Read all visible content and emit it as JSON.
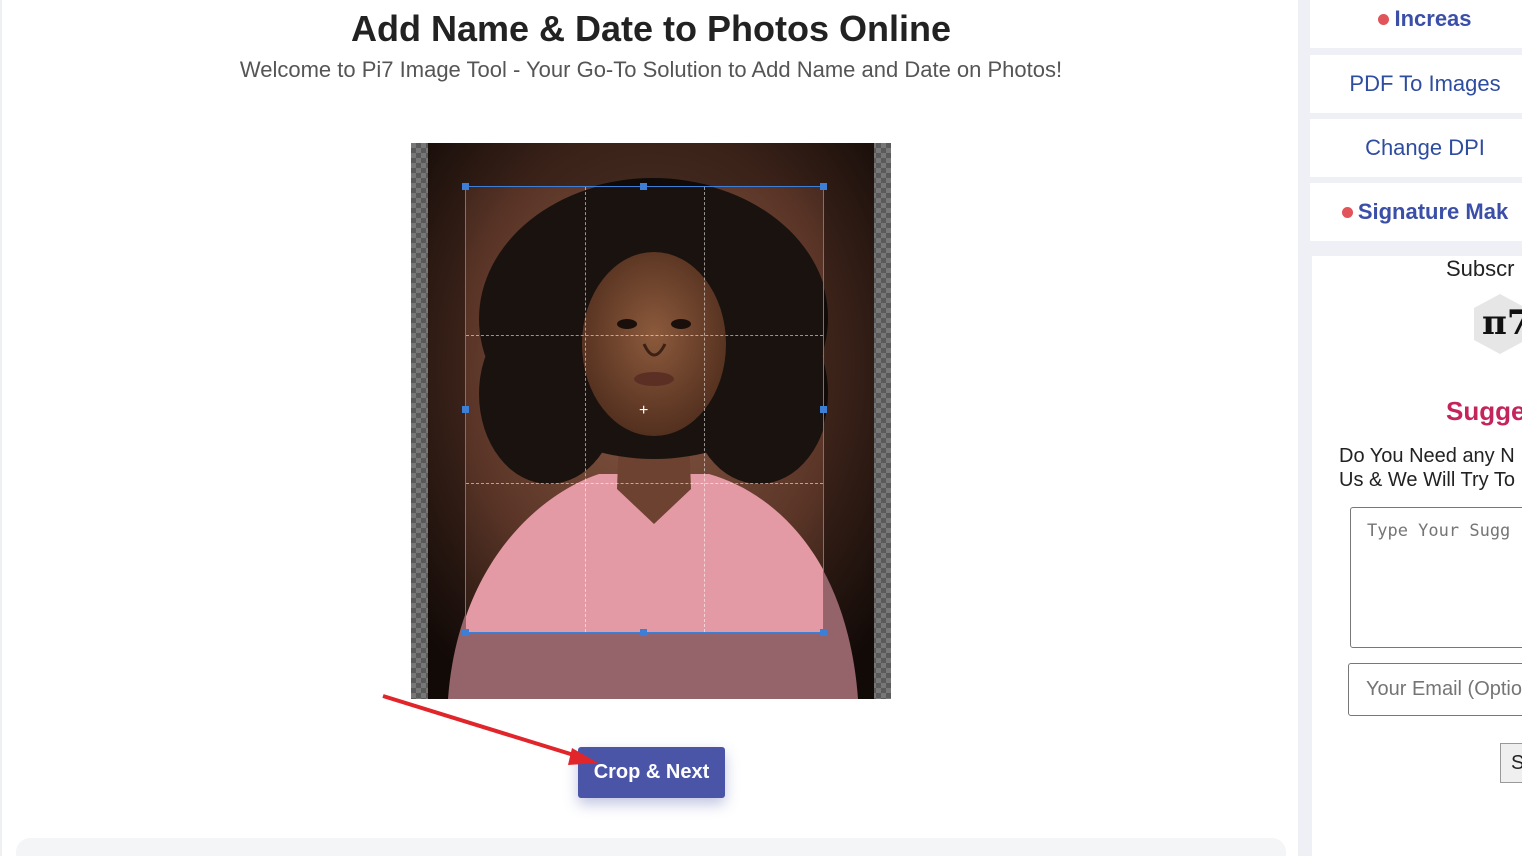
{
  "page": {
    "title": "Add Name & Date to Photos Online",
    "subtitle": "Welcome to Pi7 Image Tool - Your Go-To Solution to Add Name and Date on Photos!"
  },
  "cropper": {
    "center_marker": "+",
    "button_label": "Crop & Next"
  },
  "sidebar": {
    "links": [
      {
        "label": "Increas",
        "featured": true
      },
      {
        "label": "PDF To Images",
        "featured": false
      },
      {
        "label": "Change DPI",
        "featured": false
      },
      {
        "label": "Signature Mak",
        "featured": true
      }
    ],
    "subscribe_label": "Subscr",
    "logo_text": "π7",
    "suggest": {
      "heading": "Sugge",
      "text_line1": "Do You Need any N",
      "text_line2": "Us & We Will Try To",
      "textarea_placeholder": "Type Your Sugg",
      "email_placeholder": "Your Email (Optio",
      "submit_label": "S"
    }
  },
  "colors": {
    "accent_button": "#4a55a8",
    "link_blue": "#2f4da0",
    "dot_red": "#e0545a",
    "suggest_heading": "#c4245b",
    "arrow": "#e0252b",
    "crop_handle": "#3d7fd6"
  }
}
